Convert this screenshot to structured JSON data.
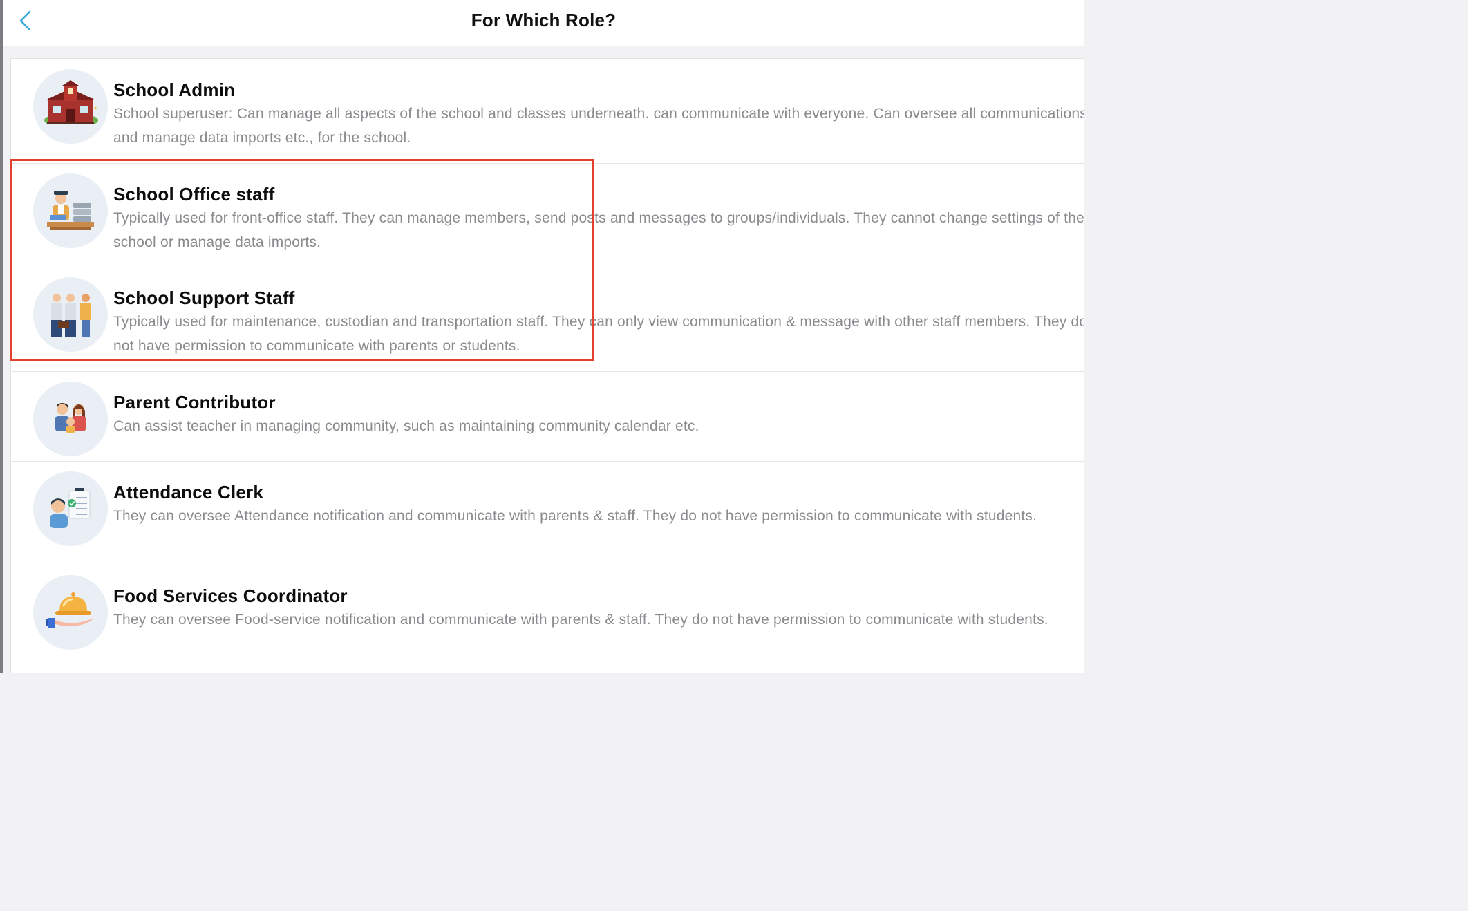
{
  "header": {
    "title": "For Which Role?",
    "back_icon": "chevron-left-icon",
    "accent_color": "#3aa8d8"
  },
  "roles": [
    {
      "title": "School Admin",
      "description": "School superuser: Can manage all aspects of the school and classes underneath. can communicate with everyone. Can oversee all communications and manage data imports etc., for the school.",
      "icon": "school-building-icon"
    },
    {
      "title": "School Office staff",
      "description": "Typically used for front-office staff. They can manage members, send posts and messages to groups/individuals. They cannot change settings of the school or manage data imports.",
      "icon": "office-staff-icon"
    },
    {
      "title": "School Support Staff",
      "description": "Typically used for maintenance, custodian and transportation staff. They can only view communication & message with other staff members. They do not have permission to communicate with parents or students.",
      "icon": "support-staff-icon"
    },
    {
      "title": "Parent Contributor",
      "description": "Can assist teacher in managing community, such as maintaining community calendar etc.",
      "icon": "parent-family-icon"
    },
    {
      "title": "Attendance Clerk",
      "description": "They can oversee Attendance notification and communicate with parents & staff. They do not have permission to communicate with students.",
      "icon": "attendance-clerk-icon"
    },
    {
      "title": "Food Services Coordinator",
      "description": "They can oversee Food-service notification and communicate with parents & staff. They do not have permission to communicate with students.",
      "icon": "food-cloche-icon"
    }
  ],
  "highlight_color": "#e2422d"
}
